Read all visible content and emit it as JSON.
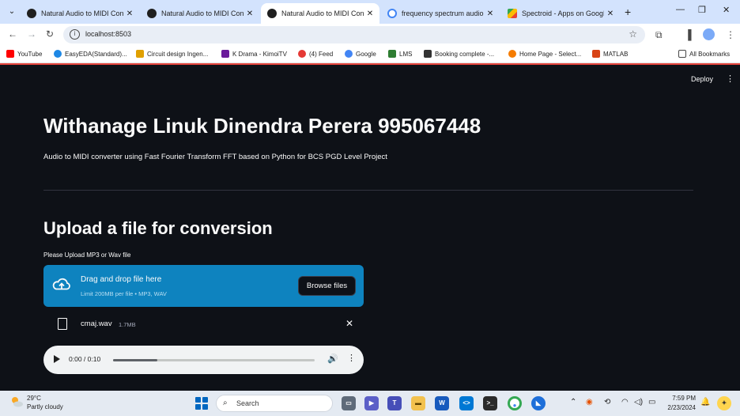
{
  "browser": {
    "tabs": [
      {
        "title": "Natural Audio to MIDI Conv",
        "active": false,
        "favicon": "streamlit-icon"
      },
      {
        "title": "Natural Audio to MIDI Conv",
        "active": false,
        "favicon": "streamlit-icon"
      },
      {
        "title": "Natural Audio to MIDI Conv",
        "active": true,
        "favicon": "streamlit-icon"
      },
      {
        "title": "frequency spectrum audio s",
        "active": false,
        "favicon": "google-icon"
      },
      {
        "title": "Spectroid - Apps on Google",
        "active": false,
        "favicon": "google-play-icon"
      }
    ],
    "url": "localhost:8503",
    "bookmarks": [
      {
        "label": "YouTube",
        "color": "#ff0000"
      },
      {
        "label": "EasyEDA(Standard)...",
        "color": "#1e88e5"
      },
      {
        "label": "Circuit design Ingen...",
        "color": "#e0a000"
      },
      {
        "label": "K Drama - KimoiTV",
        "color": "#6a1b9a"
      },
      {
        "label": "(4) Feed",
        "color": "#e53935"
      },
      {
        "label": "Google",
        "color": "#4285f4"
      },
      {
        "label": "LMS",
        "color": "#2e7d32"
      },
      {
        "label": "Booking complete -...",
        "color": "#333333"
      },
      {
        "label": "Home Page - Select...",
        "color": "#f57c00"
      },
      {
        "label": "MATLAB",
        "color": "#d84315"
      }
    ],
    "all_bookmarks": "All Bookmarks"
  },
  "app": {
    "deploy_label": "Deploy",
    "title": "Withanage Linuk Dinendra Perera 995067448",
    "subtitle": "Audio to MIDI converter using Fast Fourier Transform FFT based on Python for BCS PGD Level Project",
    "section_heading": "Upload a file for conversion",
    "uploader": {
      "label": "Please Upload MP3 or Wav file",
      "drag_text": "Drag and drop file here",
      "limit_text": "Limit 200MB per file • MP3, WAV",
      "browse_label": "Browse files"
    },
    "file": {
      "name": "cmaj.wav",
      "size": "1.7MB"
    },
    "audio_player": {
      "time": "0:00 / 0:10",
      "progress": 0.22
    }
  },
  "taskbar": {
    "temperature": "29°C",
    "condition": "Partly cloudy",
    "search_placeholder": "Search",
    "time": "7:59 PM",
    "date": "2/23/2024"
  },
  "colors": {
    "app_bg": "#0e1117",
    "uploader_bg": "#0e83bf",
    "accent_line": "#e6443d"
  }
}
